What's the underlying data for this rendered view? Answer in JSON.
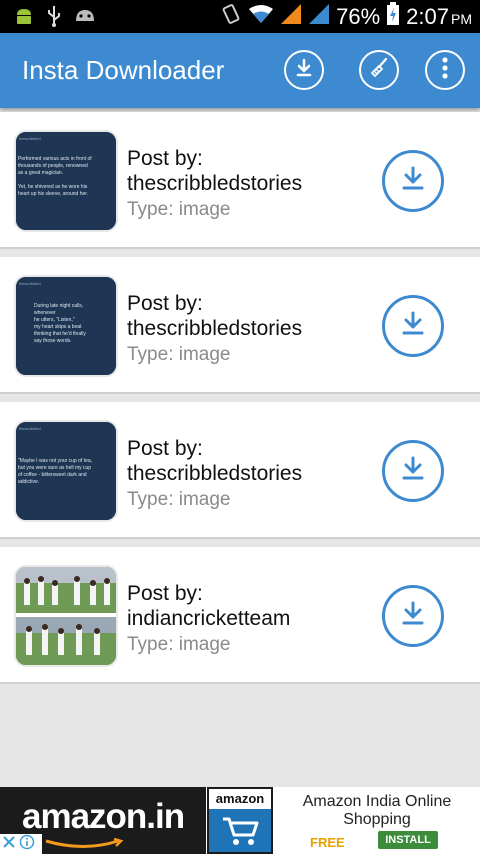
{
  "status_bar": {
    "battery": "76%",
    "time": "2:07",
    "ampm": "PM",
    "icons": [
      "android-icon",
      "usb-icon",
      "android-debug-icon",
      "vibrate-icon",
      "wifi-icon",
      "signal-icon",
      "signal-icon",
      "battery-icon"
    ]
  },
  "app_bar": {
    "title": "Insta Downloader",
    "actions": [
      "download-icon",
      "broom-icon",
      "more-icon"
    ]
  },
  "posts": [
    {
      "post_by_label": "Post by:",
      "author": "thescribbledstories",
      "type": "Type: image",
      "thumb_text": [
        "Performed various acts in front of",
        "thousands of people, renowned",
        "as a great magician.",
        "",
        "Yet, he shivered as he wore his",
        "heart up his sleeve, around her."
      ]
    },
    {
      "post_by_label": "Post by:",
      "author": "thescribbledstories",
      "type": "Type: image",
      "thumb_text": [
        "During late night calls,",
        "whenever",
        "he utters, \"Listen,\"",
        "my heart skips a beat",
        "thinking that he'd finally",
        "say those words."
      ]
    },
    {
      "post_by_label": "Post by:",
      "author": "thescribbledstories",
      "type": "Type: image",
      "thumb_text": [
        "\"Maybe I was not your cup of tea,",
        "but you were sure as hell my cup",
        "of coffee - bittersweet dark and",
        "addictive."
      ]
    },
    {
      "post_by_label": "Post by:",
      "author": "indiancricketteam",
      "type": "Type: image",
      "thumb_text": []
    }
  ],
  "ad": {
    "brand": "amazon.in",
    "logo_label": "amazon",
    "headline": "Amazon India Online Shopping",
    "price": "FREE",
    "cta": "INSTALL"
  },
  "colors": {
    "app_bar": "#3d8ad0",
    "accent": "#3d8ad0",
    "thumb_bg": "#1e3653"
  }
}
